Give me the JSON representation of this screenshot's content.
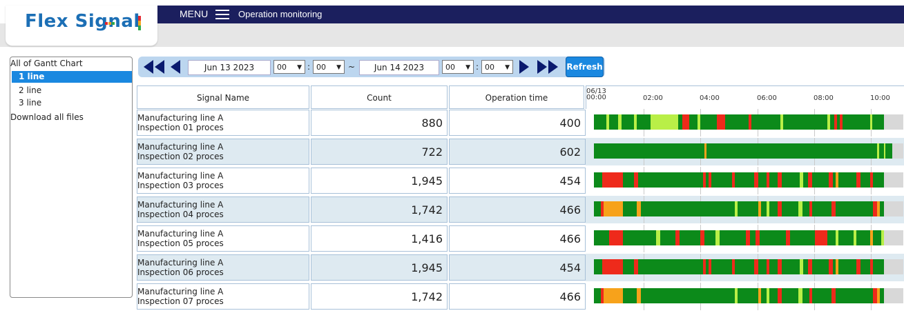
{
  "app": {
    "logo_text": "Flex Signal",
    "menu_label": "MENU",
    "page_title": "Operation monitoring"
  },
  "sidebar": {
    "title": "All of Gantt Chart",
    "items": [
      {
        "label": "1 line",
        "active": true
      },
      {
        "label": "2 line",
        "active": false
      },
      {
        "label": "3 line",
        "active": false
      }
    ],
    "download_label": "Download all files"
  },
  "controls": {
    "start_date": "Jun 13 2023",
    "start_hour": "00",
    "start_minute": "00",
    "range_sep": "~",
    "end_date": "Jun 14 2023",
    "end_hour": "00",
    "end_minute": "00",
    "refresh_label": "Refresh"
  },
  "table": {
    "headers": {
      "signal_name": "Signal Name",
      "count": "Count",
      "operation_time": "Operation time"
    },
    "gantt_date": "06/13",
    "ticks": [
      "00:00",
      "02:00",
      "04:00",
      "06:00",
      "08:00",
      "10:00"
    ],
    "rows": [
      {
        "line1": "Manufacturing line A",
        "line2": "Inspection 01 proces",
        "count": "880",
        "op": "400",
        "bg": "#ffffff",
        "pattern": 0
      },
      {
        "line1": "Manufacturing line A",
        "line2": "Inspection 02 proces",
        "count": "722",
        "op": "602",
        "bg": "#deeaf1",
        "pattern": 1
      },
      {
        "line1": "Manufacturing line A",
        "line2": "Inspection 03 proces",
        "count": "1,945",
        "op": "454",
        "bg": "#ffffff",
        "pattern": 2
      },
      {
        "line1": "Manufacturing line A",
        "line2": "Inspection 04 proces",
        "count": "1,742",
        "op": "466",
        "bg": "#deeaf1",
        "pattern": 3
      },
      {
        "line1": "Manufacturing line A",
        "line2": "Inspection 05 proces",
        "count": "1,416",
        "op": "466",
        "bg": "#ffffff",
        "pattern": 4
      },
      {
        "line1": "Manufacturing line A",
        "line2": "Inspection 06 proces",
        "count": "1,945",
        "op": "454",
        "bg": "#deeaf1",
        "pattern": 2
      },
      {
        "line1": "Manufacturing line A",
        "line2": "Inspection 07 proces",
        "count": "1,742",
        "op": "466",
        "bg": "#ffffff",
        "pattern": 3
      }
    ]
  },
  "colors": {
    "running": "#0c8a1a",
    "stopped": "#ee2a1b",
    "idle": "#f7a21b",
    "setup": "#b9ef47",
    "none": "#d8d8d8",
    "navbar": "#1b1f5e",
    "accent": "#1a88e0"
  },
  "icons": {
    "first": "double-left-arrow-icon",
    "prev": "left-arrow-icon",
    "next": "right-arrow-icon",
    "last": "double-right-arrow-icon",
    "menu": "hamburger-icon"
  }
}
